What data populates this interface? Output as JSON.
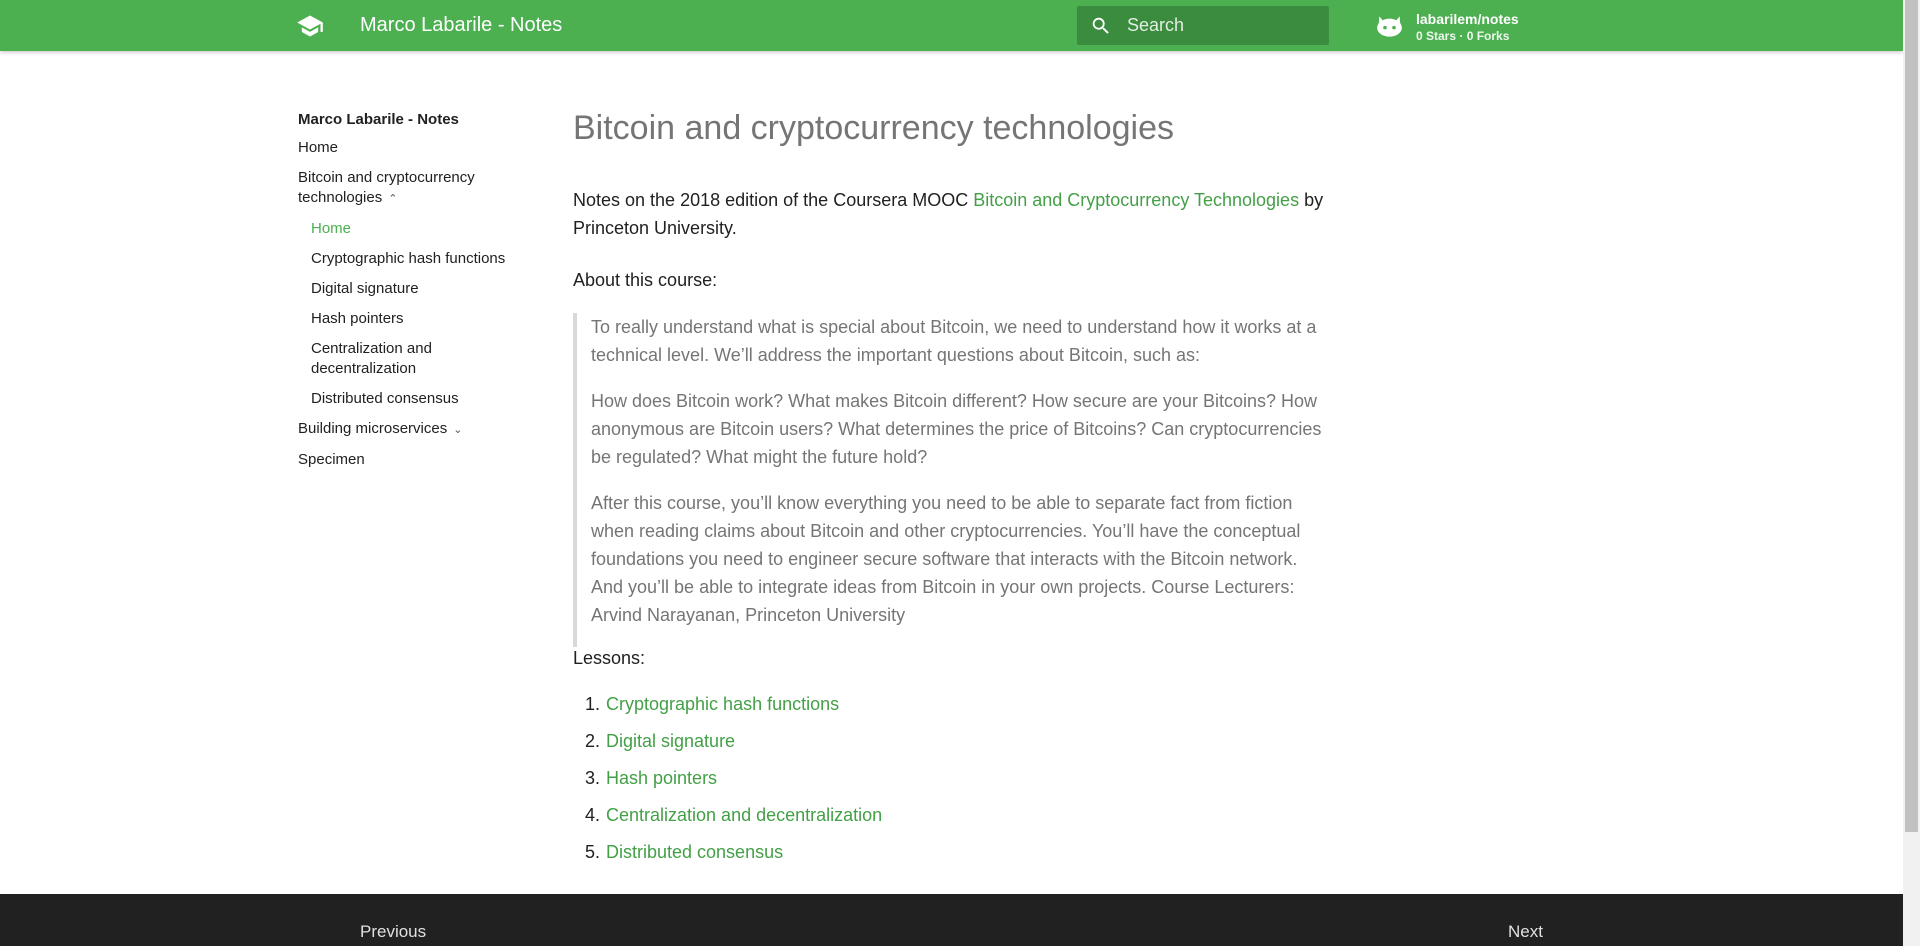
{
  "header": {
    "site_title": "Marco Labarile - Notes",
    "search_placeholder": "Search",
    "repo_name": "labarilem/notes",
    "repo_stats": "0 Stars · 0 Forks",
    "logo_icon": "graduation-cap-icon",
    "repo_icon": "github-octocat-icon",
    "accent_color": "#4caf50"
  },
  "sidebar": {
    "title": "Marco Labarile - Notes",
    "items": [
      {
        "label": "Home"
      },
      {
        "label": "Bitcoin and cryptocurrency technologies",
        "expanded": true
      },
      {
        "label": "Home",
        "active": true
      },
      {
        "label": "Cryptographic hash functions"
      },
      {
        "label": "Digital signature"
      },
      {
        "label": "Hash pointers"
      },
      {
        "label": "Centralization and decentralization"
      },
      {
        "label": "Distributed consensus"
      },
      {
        "label": "Building microservices",
        "expanded": false
      },
      {
        "label": "Specimen"
      }
    ]
  },
  "main": {
    "title": "Bitcoin and cryptocurrency technologies",
    "intro_before": "Notes on the 2018 edition of the Coursera MOOC ",
    "intro_link": "Bitcoin and Cryptocurrency Technologies",
    "intro_after": " by Princeton University.",
    "about_label": "About this course:",
    "quote": [
      "To really understand what is special about Bitcoin, we need to understand how it works at a technical level. We’ll address the important questions about Bitcoin, such as:",
      "How does Bitcoin work? What makes Bitcoin different? How secure are your Bitcoins? How anonymous are Bitcoin users? What determines the price of Bitcoins? Can cryptocurrencies be regulated? What might the future hold?",
      "After this course, you’ll know everything you need to be able to separate fact from fiction when reading claims about Bitcoin and other cryptocurrencies. You’ll have the conceptual foundations you need to engineer secure software that interacts with the Bitcoin network. And you’ll be able to integrate ideas from Bitcoin in your own projects. Course Lecturers: Arvind Narayanan, Princeton University"
    ],
    "lessons_label": "Lessons:",
    "lessons": [
      {
        "num": "1.",
        "label": "Cryptographic hash functions"
      },
      {
        "num": "2.",
        "label": "Digital signature"
      },
      {
        "num": "3.",
        "label": "Hash pointers"
      },
      {
        "num": "4.",
        "label": "Centralization and decentralization"
      },
      {
        "num": "5.",
        "label": "Distributed consensus"
      }
    ]
  },
  "footer": {
    "previous_label": "Previous",
    "next_label": "Next"
  }
}
